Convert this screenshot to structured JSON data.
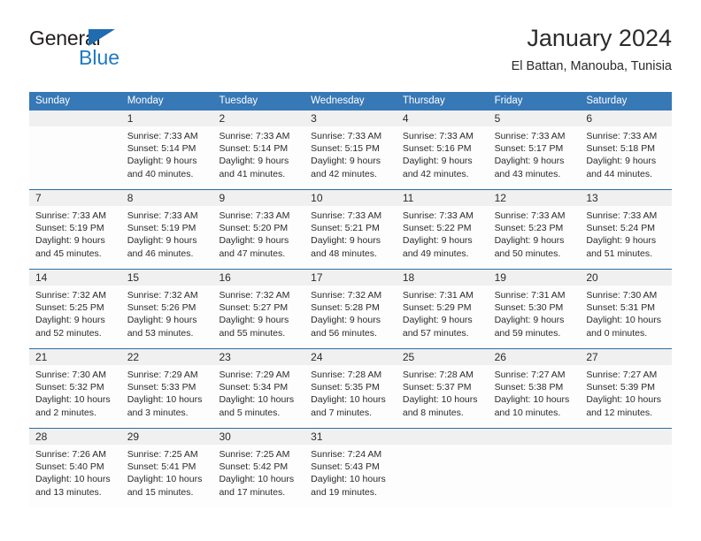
{
  "brand": {
    "name_dark": "General",
    "name_blue": "Blue",
    "accent_color": "#1f7ac4",
    "triangle_color": "#1f6cb0"
  },
  "header": {
    "title": "January 2024",
    "subtitle": "El Battan, Manouba, Tunisia"
  },
  "theme": {
    "header_row_bg": "#3778b6",
    "week_divider": "#2e6da4",
    "daynum_band_bg": "#f0f0f0",
    "text_color": "#2b2b2b"
  },
  "calendar": {
    "day_headers": [
      "Sunday",
      "Monday",
      "Tuesday",
      "Wednesday",
      "Thursday",
      "Friday",
      "Saturday"
    ],
    "weeks": [
      [
        {
          "day": "",
          "lines": []
        },
        {
          "day": "1",
          "lines": [
            "Sunrise: 7:33 AM",
            "Sunset: 5:14 PM",
            "Daylight: 9 hours",
            "and 40 minutes."
          ]
        },
        {
          "day": "2",
          "lines": [
            "Sunrise: 7:33 AM",
            "Sunset: 5:14 PM",
            "Daylight: 9 hours",
            "and 41 minutes."
          ]
        },
        {
          "day": "3",
          "lines": [
            "Sunrise: 7:33 AM",
            "Sunset: 5:15 PM",
            "Daylight: 9 hours",
            "and 42 minutes."
          ]
        },
        {
          "day": "4",
          "lines": [
            "Sunrise: 7:33 AM",
            "Sunset: 5:16 PM",
            "Daylight: 9 hours",
            "and 42 minutes."
          ]
        },
        {
          "day": "5",
          "lines": [
            "Sunrise: 7:33 AM",
            "Sunset: 5:17 PM",
            "Daylight: 9 hours",
            "and 43 minutes."
          ]
        },
        {
          "day": "6",
          "lines": [
            "Sunrise: 7:33 AM",
            "Sunset: 5:18 PM",
            "Daylight: 9 hours",
            "and 44 minutes."
          ]
        }
      ],
      [
        {
          "day": "7",
          "lines": [
            "Sunrise: 7:33 AM",
            "Sunset: 5:19 PM",
            "Daylight: 9 hours",
            "and 45 minutes."
          ]
        },
        {
          "day": "8",
          "lines": [
            "Sunrise: 7:33 AM",
            "Sunset: 5:19 PM",
            "Daylight: 9 hours",
            "and 46 minutes."
          ]
        },
        {
          "day": "9",
          "lines": [
            "Sunrise: 7:33 AM",
            "Sunset: 5:20 PM",
            "Daylight: 9 hours",
            "and 47 minutes."
          ]
        },
        {
          "day": "10",
          "lines": [
            "Sunrise: 7:33 AM",
            "Sunset: 5:21 PM",
            "Daylight: 9 hours",
            "and 48 minutes."
          ]
        },
        {
          "day": "11",
          "lines": [
            "Sunrise: 7:33 AM",
            "Sunset: 5:22 PM",
            "Daylight: 9 hours",
            "and 49 minutes."
          ]
        },
        {
          "day": "12",
          "lines": [
            "Sunrise: 7:33 AM",
            "Sunset: 5:23 PM",
            "Daylight: 9 hours",
            "and 50 minutes."
          ]
        },
        {
          "day": "13",
          "lines": [
            "Sunrise: 7:33 AM",
            "Sunset: 5:24 PM",
            "Daylight: 9 hours",
            "and 51 minutes."
          ]
        }
      ],
      [
        {
          "day": "14",
          "lines": [
            "Sunrise: 7:32 AM",
            "Sunset: 5:25 PM",
            "Daylight: 9 hours",
            "and 52 minutes."
          ]
        },
        {
          "day": "15",
          "lines": [
            "Sunrise: 7:32 AM",
            "Sunset: 5:26 PM",
            "Daylight: 9 hours",
            "and 53 minutes."
          ]
        },
        {
          "day": "16",
          "lines": [
            "Sunrise: 7:32 AM",
            "Sunset: 5:27 PM",
            "Daylight: 9 hours",
            "and 55 minutes."
          ]
        },
        {
          "day": "17",
          "lines": [
            "Sunrise: 7:32 AM",
            "Sunset: 5:28 PM",
            "Daylight: 9 hours",
            "and 56 minutes."
          ]
        },
        {
          "day": "18",
          "lines": [
            "Sunrise: 7:31 AM",
            "Sunset: 5:29 PM",
            "Daylight: 9 hours",
            "and 57 minutes."
          ]
        },
        {
          "day": "19",
          "lines": [
            "Sunrise: 7:31 AM",
            "Sunset: 5:30 PM",
            "Daylight: 9 hours",
            "and 59 minutes."
          ]
        },
        {
          "day": "20",
          "lines": [
            "Sunrise: 7:30 AM",
            "Sunset: 5:31 PM",
            "Daylight: 10 hours",
            "and 0 minutes."
          ]
        }
      ],
      [
        {
          "day": "21",
          "lines": [
            "Sunrise: 7:30 AM",
            "Sunset: 5:32 PM",
            "Daylight: 10 hours",
            "and 2 minutes."
          ]
        },
        {
          "day": "22",
          "lines": [
            "Sunrise: 7:29 AM",
            "Sunset: 5:33 PM",
            "Daylight: 10 hours",
            "and 3 minutes."
          ]
        },
        {
          "day": "23",
          "lines": [
            "Sunrise: 7:29 AM",
            "Sunset: 5:34 PM",
            "Daylight: 10 hours",
            "and 5 minutes."
          ]
        },
        {
          "day": "24",
          "lines": [
            "Sunrise: 7:28 AM",
            "Sunset: 5:35 PM",
            "Daylight: 10 hours",
            "and 7 minutes."
          ]
        },
        {
          "day": "25",
          "lines": [
            "Sunrise: 7:28 AM",
            "Sunset: 5:37 PM",
            "Daylight: 10 hours",
            "and 8 minutes."
          ]
        },
        {
          "day": "26",
          "lines": [
            "Sunrise: 7:27 AM",
            "Sunset: 5:38 PM",
            "Daylight: 10 hours",
            "and 10 minutes."
          ]
        },
        {
          "day": "27",
          "lines": [
            "Sunrise: 7:27 AM",
            "Sunset: 5:39 PM",
            "Daylight: 10 hours",
            "and 12 minutes."
          ]
        }
      ],
      [
        {
          "day": "28",
          "lines": [
            "Sunrise: 7:26 AM",
            "Sunset: 5:40 PM",
            "Daylight: 10 hours",
            "and 13 minutes."
          ]
        },
        {
          "day": "29",
          "lines": [
            "Sunrise: 7:25 AM",
            "Sunset: 5:41 PM",
            "Daylight: 10 hours",
            "and 15 minutes."
          ]
        },
        {
          "day": "30",
          "lines": [
            "Sunrise: 7:25 AM",
            "Sunset: 5:42 PM",
            "Daylight: 10 hours",
            "and 17 minutes."
          ]
        },
        {
          "day": "31",
          "lines": [
            "Sunrise: 7:24 AM",
            "Sunset: 5:43 PM",
            "Daylight: 10 hours",
            "and 19 minutes."
          ]
        },
        {
          "day": "",
          "lines": []
        },
        {
          "day": "",
          "lines": []
        },
        {
          "day": "",
          "lines": []
        }
      ]
    ]
  }
}
